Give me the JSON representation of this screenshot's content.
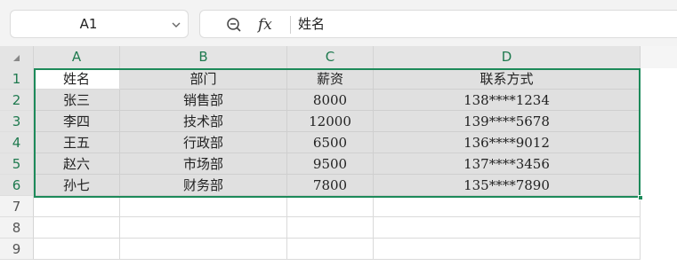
{
  "formula_bar": {
    "name_box": "A1",
    "fx_label": "fx",
    "content": "姓名"
  },
  "columns": [
    "A",
    "B",
    "C",
    "D"
  ],
  "rows": [
    "1",
    "2",
    "3",
    "4",
    "5",
    "6",
    "7",
    "8",
    "9"
  ],
  "table": [
    [
      "姓名",
      "部门",
      "薪资",
      "联系方式"
    ],
    [
      "张三",
      "销售部",
      "8000",
      "138****1234"
    ],
    [
      "李四",
      "技术部",
      "12000",
      "139****5678"
    ],
    [
      "王五",
      "行政部",
      "6500",
      "136****9012"
    ],
    [
      "赵六",
      "市场部",
      "9500",
      "137****3456"
    ],
    [
      "孙七",
      "财务部",
      "7800",
      "135****7890"
    ]
  ],
  "colors": {
    "accent": "#1d8a5a",
    "header_text": "#1f7a4f",
    "selection_fill": "#e0e0e0"
  },
  "icons": {
    "name_box_dropdown": "chevron-down-icon",
    "zoom": "zoom-out-icon"
  }
}
